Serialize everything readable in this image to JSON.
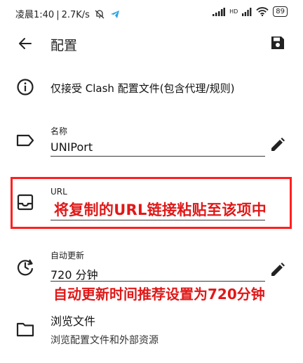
{
  "status_bar": {
    "time": "凌晨1:40",
    "speed": "2.7K/s",
    "network": "HD",
    "battery": "89"
  },
  "toolbar": {
    "title": "配置"
  },
  "info": {
    "text": "仅接受 Clash 配置文件(包含代理/规则)"
  },
  "fields": {
    "name": {
      "label": "名称",
      "value": "UNIPort"
    },
    "url": {
      "label": "URL",
      "value": ""
    },
    "auto_update": {
      "label": "自动更新",
      "value": "720 分钟"
    }
  },
  "annotations": {
    "url_hint": "将复制的URL链接粘贴至该项中",
    "update_hint": "自动更新时间推荐设置为720分钟"
  },
  "browse": {
    "title": "浏览文件",
    "subtitle": "浏览配置文件和外部资源"
  },
  "colors": {
    "annotation_red": "#e01818",
    "text_primary": "#1f1f1f"
  }
}
